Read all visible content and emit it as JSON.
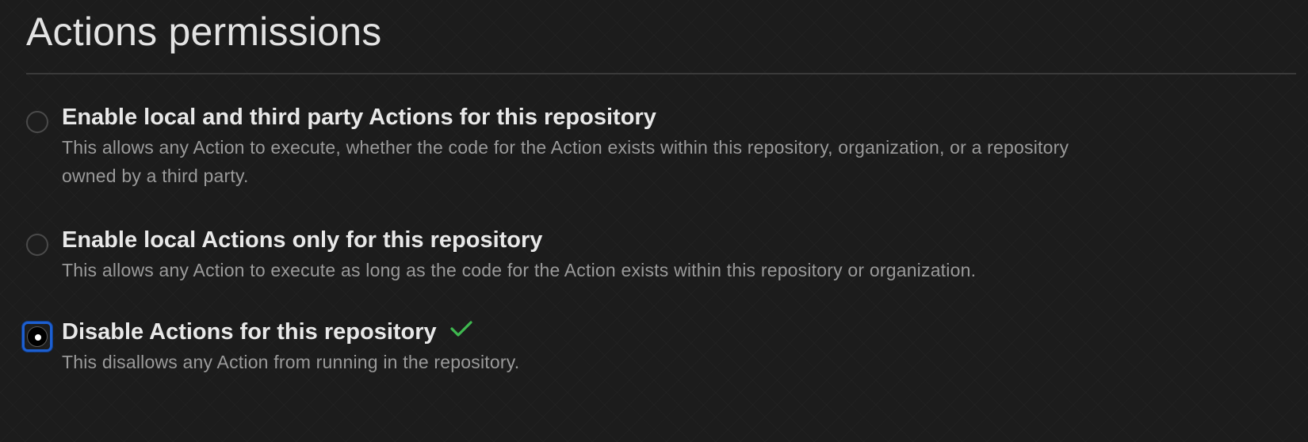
{
  "page": {
    "title": "Actions permissions"
  },
  "options": [
    {
      "label": "Enable local and third party Actions for this repository",
      "description_line1": "This allows any Action to execute, whether the code for the Action exists within this repository, organization, or a repository",
      "description_line2": "owned by a third party.",
      "selected": false
    },
    {
      "label": "Enable local Actions only for this repository",
      "description_line1": "This allows any Action to execute as long as the code for the Action exists within this repository or organization.",
      "selected": false
    },
    {
      "label": "Disable Actions for this repository",
      "description_line1": "This disallows any Action from running in the repository.",
      "selected": true,
      "status_icon": "check-icon"
    }
  ],
  "colors": {
    "background": "#1c1c1c",
    "focus_ring": "#1d5fd1",
    "success": "#3fb950",
    "description_text": "#9a9a9a"
  }
}
